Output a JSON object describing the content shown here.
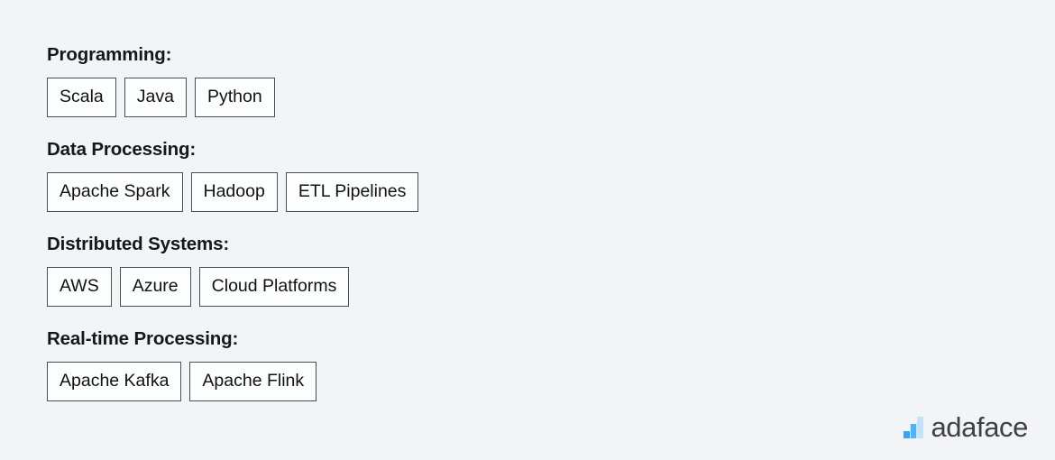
{
  "page": {
    "background_color": "#f2f4f7",
    "text_color": "#15171a",
    "tag_border_color": "#4a4f55",
    "tag_background_color": "#fcfdfd"
  },
  "skill_groups": [
    {
      "heading": "Programming:",
      "tags": [
        "Scala",
        "Java",
        "Python"
      ]
    },
    {
      "heading": "Data Processing:",
      "tags": [
        "Apache Spark",
        "Hadoop",
        "ETL Pipelines"
      ]
    },
    {
      "heading": "Distributed Systems:",
      "tags": [
        "AWS",
        "Azure",
        "Cloud Platforms"
      ]
    },
    {
      "heading": "Real-time Processing:",
      "tags": [
        "Apache Kafka",
        "Apache Flink"
      ]
    }
  ],
  "brand": {
    "name": "adaface",
    "logo_icon": "bar-chart-logo-icon",
    "mark_colors": [
      "#3fa3e8",
      "#4db5f0",
      "#c3e3f8"
    ],
    "name_color": "#3f4045"
  }
}
